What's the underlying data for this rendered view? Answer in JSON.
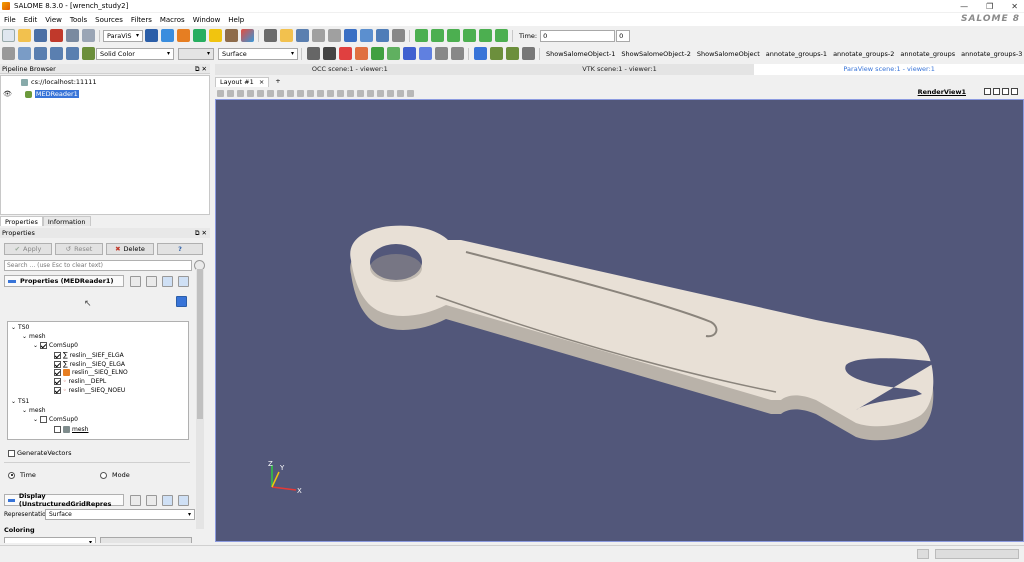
{
  "window": {
    "title": "SALOME 8.3.0 - [wrench_study2]",
    "brand": "SALOME 8"
  },
  "menu": [
    "File",
    "Edit",
    "View",
    "Tools",
    "Sources",
    "Filters",
    "Macros",
    "Window",
    "Help"
  ],
  "toolbar": {
    "module_combo": "ParaViS",
    "color_combo": "Solid Color",
    "repr_combo": "Surface",
    "time_label": "Time:",
    "time_value": "0",
    "time_index": "0",
    "macros": [
      "ShowSalomeObject-1",
      "ShowSalomeObject-2",
      "ShowSalomeObject",
      "annotate_groups-1",
      "annotate_groups-2",
      "annotate_groups",
      "annotate_groups-3"
    ]
  },
  "pipeline": {
    "header": "Pipeline Browser",
    "server": "cs://localhost:11111",
    "reader": "MEDReader1"
  },
  "panel_tabs": [
    "Properties",
    "Information"
  ],
  "properties": {
    "header": "Properties",
    "apply": "Apply",
    "reset": "Reset",
    "delete": "Delete",
    "help": "?",
    "search_placeholder": "Search ... (use Esc to clear text)",
    "section_title": "Properties (MEDReader1)",
    "tree": {
      "ts0": "TS0",
      "mesh0": "mesh",
      "comsup0": "ComSup0",
      "fields": [
        "reslin__SIEF_ELGA",
        "reslin__SIEQ_ELGA",
        "reslin__SIEQ_ELNO",
        "reslin__DEPL",
        "reslin__SIEQ_NOEU"
      ],
      "ts1": "TS1",
      "mesh1": "mesh",
      "comsup1": "ComSup0",
      "mesh_leaf": "mesh"
    },
    "generate_vectors": "GenerateVectors",
    "time": "Time",
    "mode": "Mode",
    "display_title": "Display (UnstructuredGridRepres",
    "representation_label": "Representation",
    "representation_value": "Surface",
    "coloring": "Coloring"
  },
  "views": {
    "tabs": [
      "OCC scene:1 - viewer:1",
      "VTK scene:1 - viewer:1",
      "ParaView scene:1 - viewer:1"
    ],
    "active_tab": 2,
    "layout_tab": "Layout #1",
    "layout_close": "×",
    "layout_add": "+",
    "render_view": "RenderView1"
  },
  "axes": {
    "x": "X",
    "y": "Y",
    "z": "Z"
  },
  "colors": {
    "viewport_bg": "#52577a",
    "wrench": "#e8e0d6",
    "wrench_side": "#b9b2a9",
    "accent": "#3874d8"
  }
}
